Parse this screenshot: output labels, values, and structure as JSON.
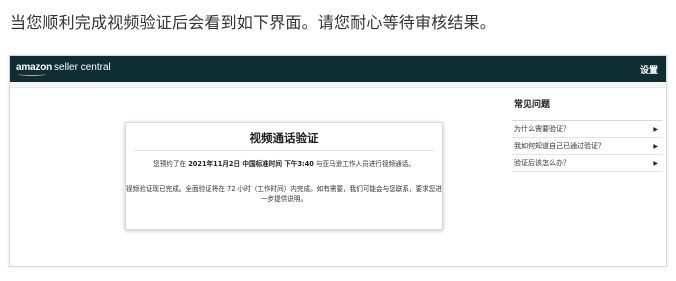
{
  "intro_text": "当您顺利完成视频验证后会看到如下界面。请您耐心等待审核结果。",
  "topbar": {
    "logo_brand": "amazon",
    "logo_product": "seller central",
    "settings_label": "设置"
  },
  "card": {
    "title": "视频通话验证",
    "line1_prefix": "您预约了在",
    "line1_datetime": "2021年11月2日 中国标准时间 下午3:40",
    "line1_suffix": "与亚马逊工作人员进行视频通话。",
    "line2": "视频验证现已完成。全面验证将在 72 小时（工作时间）内完成。如有需要，我们可能会与您联系，要求您进一步提供说明。"
  },
  "faq": {
    "title": "常见问题",
    "items": [
      {
        "label": "为什么需要验证？",
        "arrow": "▶"
      },
      {
        "label": "我如何知道自己已通过验证？",
        "arrow": "▶"
      },
      {
        "label": "验证后该怎么办？",
        "arrow": "▶"
      }
    ]
  },
  "colors": {
    "topbar_bg": "#0e2e33",
    "logo_smile": "#f0a31c"
  }
}
